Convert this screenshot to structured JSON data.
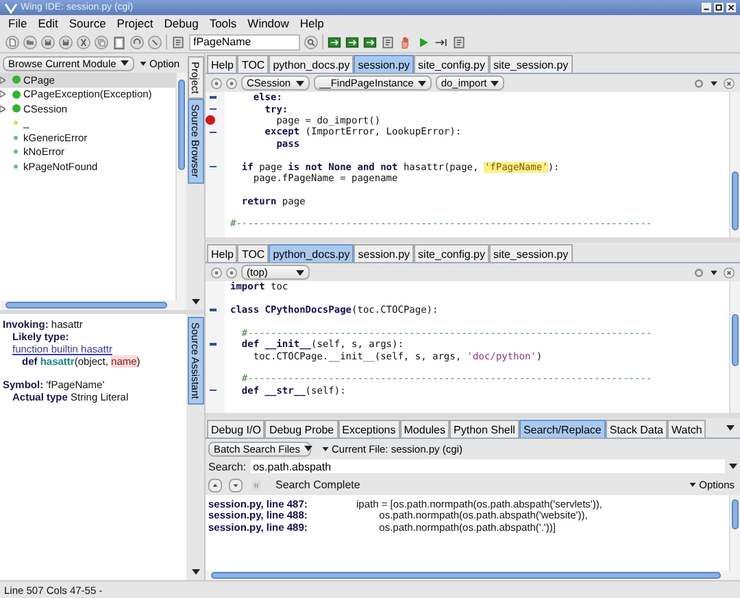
{
  "window": {
    "title": "Wing IDE: session.py (cgi)"
  },
  "menu": [
    "File",
    "Edit",
    "Source",
    "Project",
    "Debug",
    "Tools",
    "Window",
    "Help"
  ],
  "toolbar": {
    "search_value": "fPageName"
  },
  "browser": {
    "mode": "Browse Current Module",
    "options": "Option",
    "items": [
      {
        "name": "CPage",
        "kind": "class",
        "expandable": true,
        "selected": true
      },
      {
        "name": "CPageException(Exception)",
        "kind": "class",
        "expandable": true,
        "selected": false
      },
      {
        "name": "CSession",
        "kind": "class",
        "expandable": true,
        "selected": false
      },
      {
        "name": "_",
        "kind": "private",
        "expandable": false,
        "selected": false
      },
      {
        "name": "kGenericError",
        "kind": "variable",
        "expandable": false,
        "selected": false
      },
      {
        "name": "kNoError",
        "kind": "variable",
        "expandable": false,
        "selected": false
      },
      {
        "name": "kPageNotFound",
        "kind": "variable",
        "expandable": false,
        "selected": false
      }
    ]
  },
  "side_tabs": [
    {
      "label": "Project",
      "selected": false
    },
    {
      "label": "Source Browser",
      "selected": true
    }
  ],
  "assistant_tab": {
    "label": "Source Assistant",
    "selected": true
  },
  "assistant": [
    {
      "kind": "label",
      "label": "Invoking:",
      "value": "hasattr",
      "children": [
        {
          "kind": "link",
          "label": "Likely type:",
          "link": "function builtin hasattr",
          "children": [
            {
              "kind": "signature",
              "tokens": [
                {
                  "kind": "kw",
                  "text": "def"
                },
                {
                  "kind": "fn",
                  "text": " hasattr"
                },
                {
                  "kind": "plain",
                  "text": "(object, "
                },
                {
                  "kind": "arg",
                  "text": "name"
                },
                {
                  "kind": "plain",
                  "text": ")"
                }
              ]
            }
          ]
        }
      ]
    },
    {
      "kind": "label",
      "label": "Symbol:",
      "value": "'fPageName'",
      "children": [
        {
          "kind": "label",
          "label": "Actual type",
          "value": "String Literal"
        }
      ]
    }
  ],
  "editors": [
    {
      "tabs": [
        {
          "label": "Help",
          "selected": false
        },
        {
          "label": "TOC",
          "selected": false
        },
        {
          "label": "python_docs.py",
          "selected": false
        },
        {
          "label": "session.py",
          "selected": true
        },
        {
          "label": "site_config.py",
          "selected": false
        },
        {
          "label": "site_session.py",
          "selected": false
        }
      ],
      "scopes": [
        "CSession",
        "__FindPageInstance",
        "do_import"
      ],
      "lines": [
        {
          "fold": true,
          "breakpoint": false,
          "tokens": [
            {
              "kind": "kw",
              "text": "    else:"
            }
          ]
        },
        {
          "fold": true,
          "breakpoint": false,
          "tokens": [
            {
              "kind": "kw",
              "text": "      try:"
            }
          ]
        },
        {
          "fold": false,
          "breakpoint": true,
          "tokens": [
            {
              "kind": "plain",
              "text": "        page = do_import()"
            }
          ]
        },
        {
          "fold": true,
          "breakpoint": false,
          "tokens": [
            {
              "kind": "kw",
              "text": "      except"
            },
            {
              "kind": "plain",
              "text": " (ImportError, LookupError):"
            }
          ]
        },
        {
          "fold": false,
          "breakpoint": false,
          "tokens": [
            {
              "kind": "kw",
              "text": "        pass"
            }
          ]
        },
        {
          "fold": false,
          "breakpoint": false
        },
        {
          "fold": true,
          "breakpoint": false,
          "tokens": [
            {
              "kind": "kw",
              "text": "  if"
            },
            {
              "kind": "plain",
              "text": " page "
            },
            {
              "kind": "kw",
              "text": "is not None and not"
            },
            {
              "kind": "plain",
              "text": " hasattr(page, "
            },
            {
              "kind": "hl",
              "text": "'fPageName'"
            },
            {
              "kind": "plain",
              "text": "):"
            }
          ]
        },
        {
          "fold": false,
          "breakpoint": false,
          "tokens": [
            {
              "kind": "plain",
              "text": "    page.fPageName = pagename"
            }
          ]
        },
        {
          "fold": false,
          "breakpoint": false
        },
        {
          "fold": false,
          "breakpoint": false,
          "tokens": [
            {
              "kind": "kw",
              "text": "  return"
            },
            {
              "kind": "plain",
              "text": " page"
            }
          ]
        },
        {
          "fold": false,
          "breakpoint": false
        },
        {
          "fold": false,
          "breakpoint": false,
          "tokens": [
            {
              "kind": "comment",
              "text": "#------------------------------------------------------------------------"
            }
          ]
        }
      ]
    },
    {
      "tabs": [
        {
          "label": "Help",
          "selected": false
        },
        {
          "label": "TOC",
          "selected": false
        },
        {
          "label": "python_docs.py",
          "selected": true
        },
        {
          "label": "session.py",
          "selected": false
        },
        {
          "label": "site_config.py",
          "selected": false
        },
        {
          "label": "site_session.py",
          "selected": false
        }
      ],
      "scopes": [
        "(top)"
      ],
      "lines": [
        {
          "fold": false,
          "breakpoint": false,
          "tokens": [
            {
              "kind": "kw",
              "text": "import"
            },
            {
              "kind": "plain",
              "text": " toc"
            }
          ]
        },
        {
          "fold": false,
          "breakpoint": false
        },
        {
          "fold": true,
          "breakpoint": false,
          "tokens": [
            {
              "kind": "kw",
              "text": "class"
            },
            {
              "kind": "cls",
              "text": " CPythonDocsPage"
            },
            {
              "kind": "plain",
              "text": "(toc.CTOCPage):"
            }
          ]
        },
        {
          "fold": false,
          "breakpoint": false
        },
        {
          "fold": false,
          "breakpoint": false,
          "tokens": [
            {
              "kind": "comment",
              "text": "  #----------------------------------------------------------------------"
            }
          ]
        },
        {
          "fold": true,
          "breakpoint": false,
          "tokens": [
            {
              "kind": "kw",
              "text": "  def"
            },
            {
              "kind": "cls",
              "text": " __init__"
            },
            {
              "kind": "plain",
              "text": "(self, s, args):"
            }
          ]
        },
        {
          "fold": false,
          "breakpoint": false,
          "tokens": [
            {
              "kind": "plain",
              "text": "    toc.CTOCPage.__init__(self, s, args, "
            },
            {
              "kind": "str",
              "text": "'doc/python'"
            },
            {
              "kind": "plain",
              "text": ")"
            }
          ]
        },
        {
          "fold": false,
          "breakpoint": false
        },
        {
          "fold": false,
          "breakpoint": false,
          "tokens": [
            {
              "kind": "comment",
              "text": "  #----------------------------------------------------------------------"
            }
          ]
        },
        {
          "fold": true,
          "breakpoint": false,
          "tokens": [
            {
              "kind": "kw",
              "text": "  def"
            },
            {
              "kind": "cls",
              "text": " __str__"
            },
            {
              "kind": "plain",
              "text": "(self):"
            }
          ]
        }
      ]
    }
  ],
  "tool_tabs": [
    {
      "label": "Debug I/O",
      "selected": false
    },
    {
      "label": "Debug Probe",
      "selected": false
    },
    {
      "label": "Exceptions",
      "selected": false
    },
    {
      "label": "Modules",
      "selected": false
    },
    {
      "label": "Python Shell",
      "selected": false
    },
    {
      "label": "Search/Replace",
      "selected": true
    },
    {
      "label": "Stack Data",
      "selected": false
    },
    {
      "label": "Watch",
      "selected": false
    }
  ],
  "search": {
    "scope": "Batch Search Files",
    "file": "Current File: session.py (cgi)",
    "label": "Search:",
    "value": "os.path.abspath",
    "status": "Search Complete",
    "options": "Options",
    "results": [
      {
        "file": "session.py, line 487:",
        "code": "ipath = [os.path.normpath(os.path.abspath('servlets')),"
      },
      {
        "file": "session.py, line 488:",
        "code": "        os.path.normpath(os.path.abspath('website')),"
      },
      {
        "file": "session.py, line 489:",
        "code": "        os.path.normpath(os.path.abspath('.'))]"
      }
    ]
  },
  "status_bar": "Line 507 Cols 47-55 -"
}
